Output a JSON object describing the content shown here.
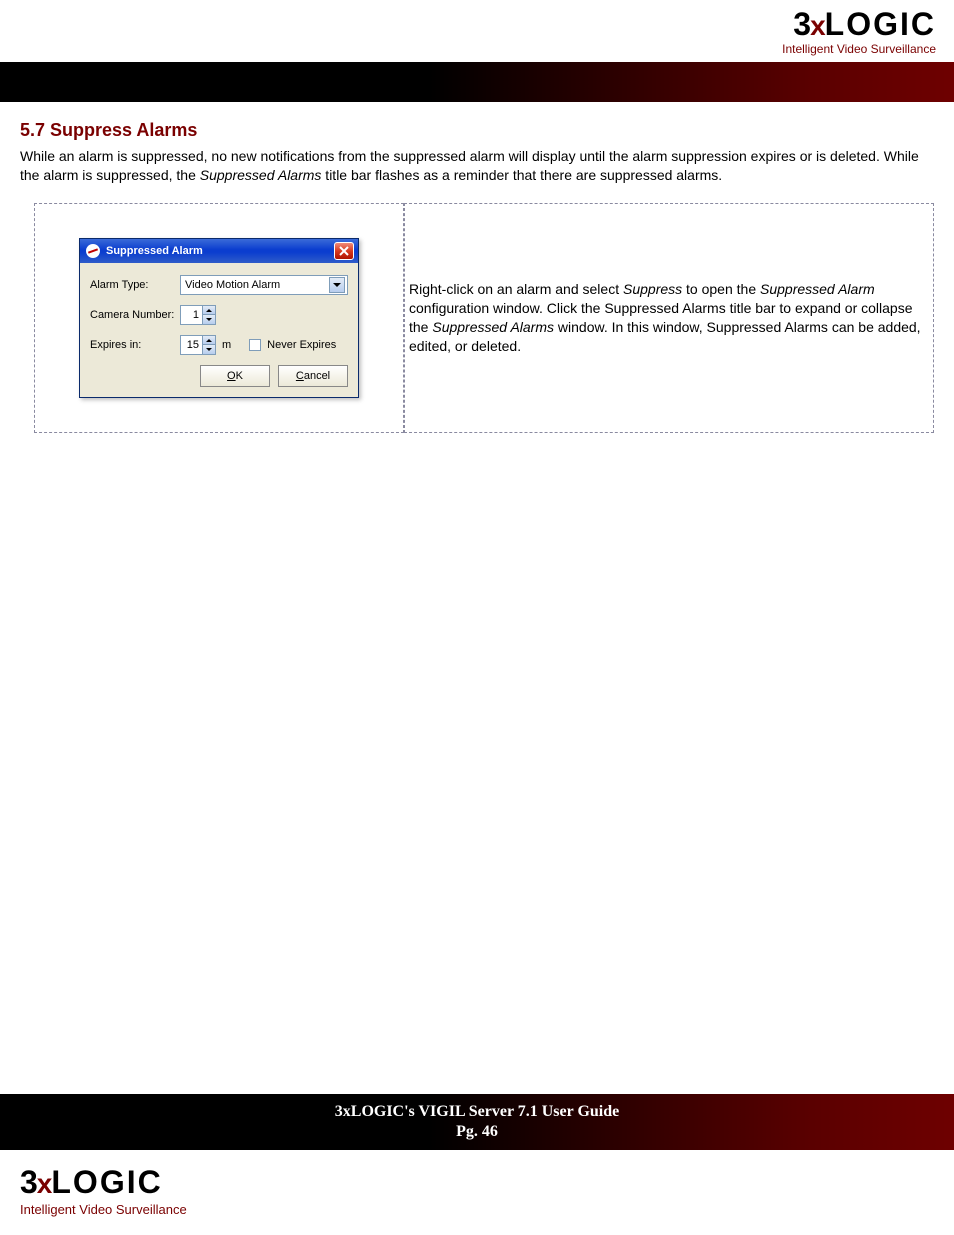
{
  "brand": {
    "part1": "3",
    "part2": "x",
    "part3": "LOGIC",
    "tagline": "Intelligent Video Surveillance"
  },
  "section": {
    "number_title": "5.7 Suppress Alarms",
    "body_before_italic": "While an alarm is suppressed, no new notifications from the suppressed alarm will display until the alarm suppression expires or is deleted. While the alarm is suppressed, the ",
    "body_italic": "Suppressed Alarms",
    "body_after_italic": " title bar flashes as a reminder that there are suppressed alarms."
  },
  "dialog": {
    "title": "Suppressed Alarm",
    "fields": {
      "alarm_type_label": "Alarm Type:",
      "alarm_type_value": "Video Motion Alarm",
      "camera_number_label": "Camera Number:",
      "camera_number_value": "1",
      "expires_in_label": "Expires in:",
      "expires_in_value": "15",
      "expires_unit": "m",
      "never_expires_label": "Never Expires"
    },
    "buttons": {
      "ok": "OK",
      "cancel": "Cancel"
    }
  },
  "instruction": {
    "seg1": "Right-click on an alarm and select ",
    "italic1": "Suppress",
    "seg2": " to open the ",
    "italic2": "Suppressed Alarm",
    "seg3": " configuration window.  Click the Suppressed Alarms title bar to expand or collapse the ",
    "italic3": "Suppressed Alarms",
    "seg4": " window. In this window, Suppressed Alarms can be added, edited, or deleted."
  },
  "footer": {
    "title": "3xLOGIC's VIGIL Server 7.1 User Guide",
    "page": "Pg. 46"
  }
}
